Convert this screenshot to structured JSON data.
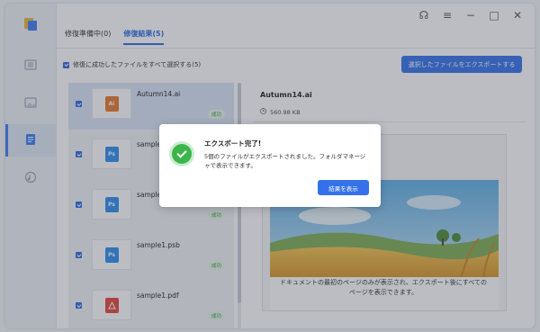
{
  "tabs": [
    {
      "label": "修復準備中(0)"
    },
    {
      "label": "修復結果(5)"
    }
  ],
  "select_all_label": "修復に成功したファイルをすべて選択する(5)",
  "export_button": "選択したファイルをエクスポートする",
  "files": [
    {
      "name": "Autumn14.ai",
      "type": "Ai",
      "status": "成功",
      "color": "#e8792a"
    },
    {
      "name": "sample",
      "type": "Ps",
      "status": "成功",
      "color": "#2d8ef0"
    },
    {
      "name": "sample",
      "type": "Ps",
      "status": "成功",
      "color": "#2d8ef0"
    },
    {
      "name": "sample1.psb",
      "type": "Ps",
      "status": "成功",
      "color": "#2d8ef0"
    },
    {
      "name": "sample1.pdf",
      "type": "pdf",
      "status": "成功",
      "color": "#e5463a"
    }
  ],
  "detail": {
    "title": "Autumn14.ai",
    "size": "560.98 KB",
    "caption_line1": "ドキュメントの最初のページのみが表示され、エクスポート後にすべての",
    "caption_line2": "ページを表示できます。"
  },
  "dialog": {
    "title": "エクスポート完了!",
    "message": "5個のファイルがエクスポートされました。フォルダマネージャで表示できます。",
    "button": "結果を表示"
  },
  "colors": {
    "accent": "#3572ea",
    "success": "#3bb54a"
  }
}
